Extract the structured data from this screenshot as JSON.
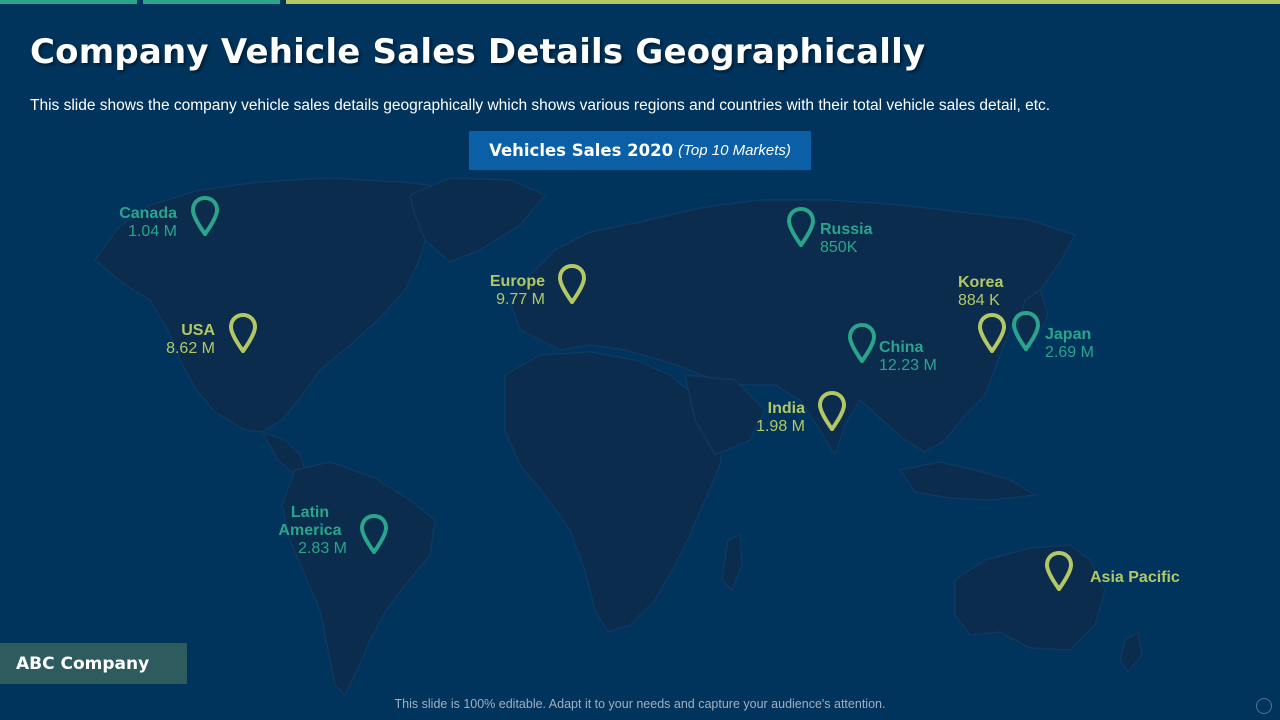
{
  "slide": {
    "title": "Company Vehicle Sales Details Geographically",
    "subtitle": "This slide shows the company vehicle sales details geographically which shows various regions and countries with their total vehicle sales detail, etc.",
    "badge_main": "Vehicles Sales 2020",
    "badge_sub": "(Top 10 Markets)",
    "company": "ABC Company",
    "footer": "This slide is 100% editable. Adapt it to your needs and capture your audience's attention."
  },
  "colors": {
    "background": "#00345c",
    "land": "#0b2c4d",
    "teal": "#2aa58c",
    "lime": "#b3c865",
    "badge": "#0a5fa6"
  },
  "markets": [
    {
      "name": "Canada",
      "value": "1.04 M",
      "color": "teal",
      "icon": "map-pin-icon"
    },
    {
      "name": "USA",
      "value": "8.62 M",
      "color": "lime",
      "icon": "map-pin-icon"
    },
    {
      "name": "Latin America",
      "value": "2.83 M",
      "color": "teal",
      "icon": "map-pin-icon"
    },
    {
      "name": "Europe",
      "value": "9.77 M",
      "color": "lime",
      "icon": "map-pin-icon"
    },
    {
      "name": "Russia",
      "value": "850K",
      "color": "teal",
      "icon": "map-pin-icon"
    },
    {
      "name": "Korea",
      "value": "884 K",
      "color": "lime",
      "icon": "map-pin-icon"
    },
    {
      "name": "Japan",
      "value": "2.69 M",
      "color": "teal",
      "icon": "map-pin-icon"
    },
    {
      "name": "China",
      "value": "12.23 M",
      "color": "teal",
      "icon": "map-pin-icon"
    },
    {
      "name": "India",
      "value": "1.98 M",
      "color": "lime",
      "icon": "map-pin-icon"
    },
    {
      "name": "Asia Pacific",
      "value": "",
      "color": "lime",
      "icon": "map-pin-icon"
    }
  ]
}
